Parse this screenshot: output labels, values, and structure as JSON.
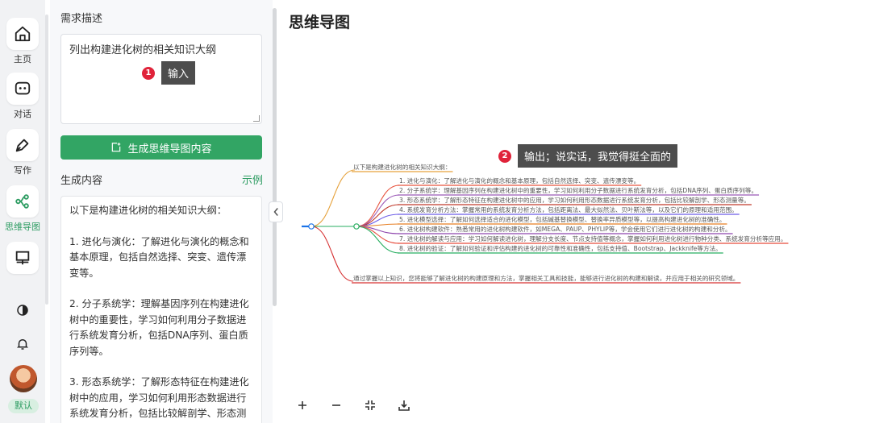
{
  "nav": {
    "items": [
      {
        "label": "主页",
        "icon": "home-icon"
      },
      {
        "label": "对话",
        "icon": "chat-icon"
      },
      {
        "label": "写作",
        "icon": "pen-icon"
      },
      {
        "label": "思维导图",
        "icon": "mindmap-icon"
      },
      {
        "label": "",
        "icon": "presentation-icon"
      }
    ],
    "active": "思维导图",
    "vip_label": "默认"
  },
  "input_panel": {
    "requirement_title": "需求描述",
    "requirement_value": "列出构建进化树的相关知识大纲",
    "generate_button": "生成思维导图内容",
    "output_title": "生成内容",
    "example_link": "示例",
    "output_paragraphs": [
      "以下是构建进化树的相关知识大纲：",
      "1. 进化与演化：了解进化与演化的概念和基本原理，包括自然选择、突变、遗传漂变等。",
      "2. 分子系统学：理解基因序列在构建进化树中的重要性，学习如何利用分子数据进行系统发育分析，包括DNA序列、蛋白质序列等。",
      "3. 形态系统学：了解形态特征在构建进化树中的应用，学习如何利用形态数据进行系统发育分析，包括比较解剖学、形态测"
    ]
  },
  "callouts": {
    "input_number": "1",
    "input_label": "输入",
    "output_number": "2",
    "output_label": "输出；说实话，我觉得挺全面的"
  },
  "mindmap": {
    "title": "思维导图",
    "intro": "以下是构建进化树的相关知识大纲：",
    "items": [
      {
        "text": "1. 进化与演化：了解进化与演化的概念和基本原理，包括自然选择、突变、遗传漂变等。",
        "color": "#e8543f"
      },
      {
        "text": "2. 分子系统学：理解基因序列在构建进化树中的重要性，学习如何利用分子数据进行系统发育分析，包括DNA序列、蛋白质序列等。",
        "color": "#9b59b6"
      },
      {
        "text": "3. 形态系统学：了解形态特征在构建进化树中的应用，学习如何利用形态数据进行系统发育分析，包括比较解剖学、形态测量等。",
        "color": "#c0392b"
      },
      {
        "text": "4. 系统发育分析方法：掌握常用的系统发育分析方法，包括距离法、最大似然法、贝叶斯法等，以及它们的原理和适用范围。",
        "color": "#6c5ce7"
      },
      {
        "text": "5. 进化模型选择：了解如何选择适合的进化模型，包括碱基替换模型、替换率异质模型等，以提高构建进化树的准确性。",
        "color": "#e67e22"
      },
      {
        "text": "6. 进化树构建软件：熟悉常用的进化树构建软件，如MEGA、PAUP、PHYLIP等，学会使用它们进行进化树的构建和分析。",
        "color": "#8e44ad"
      },
      {
        "text": "7. 进化树的解读与应用：学习如何解读进化树，理解分支长度、节点支持值等概念，掌握如何利用进化树进行物种分类、系统发育分析等应用。",
        "color": "#e74c3c"
      },
      {
        "text": "8. 进化树的验证：了解如何验证和评估构建的进化树的可靠性和准确性，包括支持值、Bootstrap、Jackknife等方法。",
        "color": "#27ae60"
      }
    ],
    "conclusion": "通过掌握以上知识，您将能够了解进化树的构建原理和方法，掌握相关工具和技能，能够进行进化树的构建和解读，并应用于相关的研究领域。",
    "intro_color": "#e6a23c",
    "conclusion_color": "#d63031",
    "trunk_color": "#1a73e8",
    "branch_color": "#27ae60"
  },
  "toolbar": [
    "zoom-in-icon",
    "zoom-out-icon",
    "fit-screen-icon",
    "download-icon"
  ],
  "accent_color": "#32a564"
}
